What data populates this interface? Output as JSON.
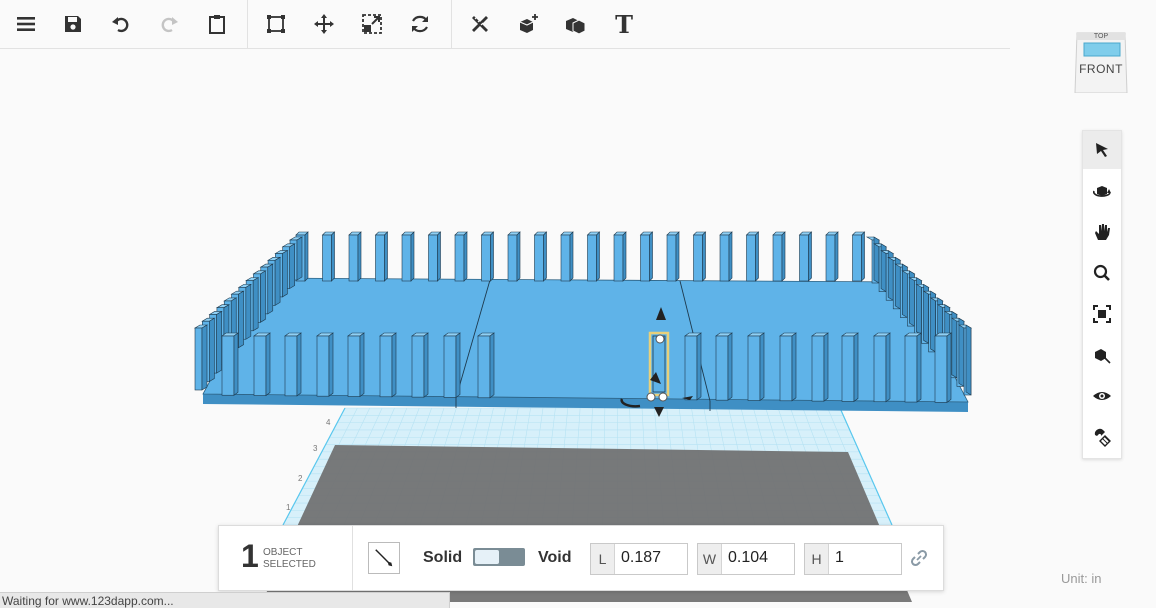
{
  "toolbar": {
    "tools": [
      "menu-icon",
      "save-icon",
      "undo-icon",
      "redo-icon",
      "paste-icon",
      "snap-grid-icon",
      "move-icon",
      "scale-icon",
      "rotate-icon",
      "measure-icon",
      "add-shape-icon",
      "group-icon",
      "text-icon"
    ],
    "text_tool_glyph": "T"
  },
  "view_cube": {
    "top_label": "TOP",
    "front_label": "FRONT"
  },
  "view_tools": [
    "select-icon",
    "orbit-icon",
    "pan-icon",
    "zoom-icon",
    "fit-view-icon",
    "perspective-icon",
    "visibility-icon",
    "snap-magnet-icon"
  ],
  "scene": {
    "grid_numbers": [
      "4",
      "3",
      "2",
      "1"
    ],
    "colors": {
      "shape": "#5fb3e8",
      "shape_dark": "#3f8fc4",
      "grid": "#bfe6f5",
      "shadow": "#6f6f6f",
      "selection": "#e8d07a"
    }
  },
  "inspector": {
    "count": "1",
    "label_line1": "OBJECT",
    "label_line2": "SELECTED",
    "solid_label": "Solid",
    "void_label": "Void",
    "length_key": "L",
    "length_value": "0.187",
    "width_key": "W",
    "width_value": "0.104",
    "height_key": "H",
    "height_value": "1"
  },
  "units_label": "Unit:  in",
  "status_text": "Waiting for www.123dapp.com..."
}
